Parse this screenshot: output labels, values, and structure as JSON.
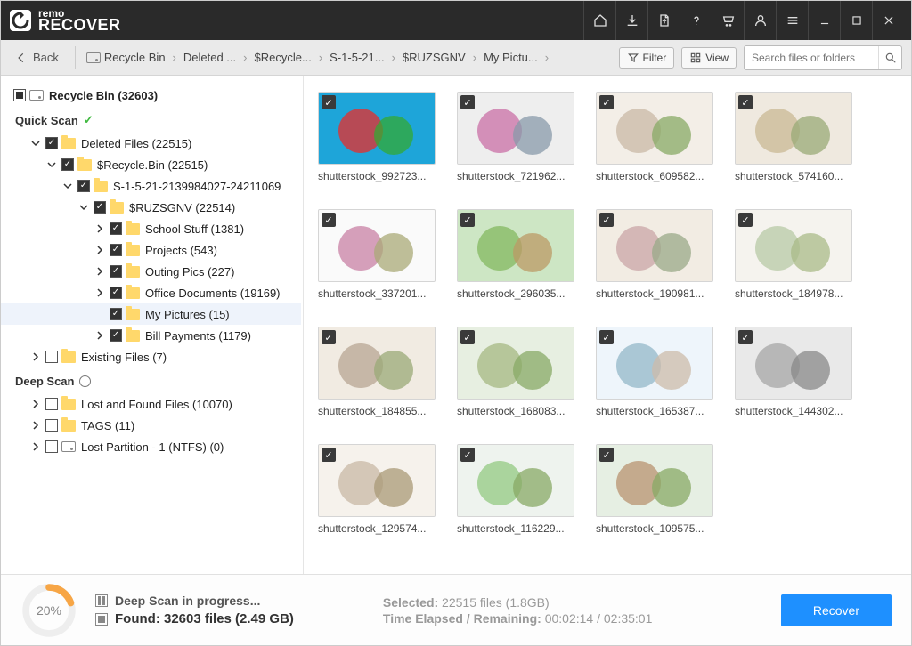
{
  "app": {
    "brand_top": "remo",
    "brand_main": "RECOVER"
  },
  "toolbar": {
    "back": "Back",
    "breadcrumb": [
      "Recycle Bin",
      "Deleted ...",
      "$Recycle...",
      "S-1-5-21...",
      "$RUZSGNV",
      "My Pictu..."
    ],
    "filter": "Filter",
    "view": "View",
    "search_placeholder": "Search files or folders"
  },
  "sidebar": {
    "root": "Recycle Bin (32603)",
    "quickscan_label": "Quick Scan",
    "deepscan_label": "Deep Scan",
    "tree": [
      {
        "label": "Deleted Files (22515)",
        "indent": 1,
        "caret": "down",
        "checked": true,
        "folder": true
      },
      {
        "label": "$Recycle.Bin (22515)",
        "indent": 2,
        "caret": "down",
        "checked": true,
        "folder": true
      },
      {
        "label": "S-1-5-21-2139984027-24211069",
        "indent": 3,
        "caret": "down",
        "checked": true,
        "folder": true
      },
      {
        "label": "$RUZSGNV (22514)",
        "indent": 4,
        "caret": "down",
        "checked": true,
        "folder": true
      },
      {
        "label": "School Stuff (1381)",
        "indent": 5,
        "caret": "right",
        "checked": true,
        "folder": true
      },
      {
        "label": "Projects (543)",
        "indent": 5,
        "caret": "right",
        "checked": true,
        "folder": true
      },
      {
        "label": "Outing Pics (227)",
        "indent": 5,
        "caret": "right",
        "checked": true,
        "folder": true
      },
      {
        "label": "Office Documents (19169)",
        "indent": 5,
        "caret": "right",
        "checked": true,
        "folder": true
      },
      {
        "label": "My Pictures (15)",
        "indent": 5,
        "caret": "none",
        "checked": true,
        "folder": true,
        "selected": true
      },
      {
        "label": "Bill Payments (1179)",
        "indent": 5,
        "caret": "right",
        "checked": true,
        "folder": true
      },
      {
        "label": "Existing Files (7)",
        "indent": 1,
        "caret": "right",
        "checked": false,
        "folder": true
      }
    ],
    "deep": [
      {
        "label": "Lost and Found Files (10070)",
        "indent": 1,
        "caret": "right",
        "checked": false,
        "folder": true
      },
      {
        "label": "TAGS (11)",
        "indent": 1,
        "caret": "right",
        "checked": false,
        "folder": true
      },
      {
        "label": "Lost Partition - 1 (NTFS) (0)",
        "indent": 1,
        "caret": "right",
        "checked": false,
        "drive": true
      }
    ]
  },
  "files": [
    {
      "name": "shutterstock_992723..."
    },
    {
      "name": "shutterstock_721962..."
    },
    {
      "name": "shutterstock_609582..."
    },
    {
      "name": "shutterstock_574160..."
    },
    {
      "name": "shutterstock_337201..."
    },
    {
      "name": "shutterstock_296035..."
    },
    {
      "name": "shutterstock_190981..."
    },
    {
      "name": "shutterstock_184978..."
    },
    {
      "name": "shutterstock_184855..."
    },
    {
      "name": "shutterstock_168083..."
    },
    {
      "name": "shutterstock_165387..."
    },
    {
      "name": "shutterstock_144302..."
    },
    {
      "name": "shutterstock_129574..."
    },
    {
      "name": "shutterstock_116229..."
    },
    {
      "name": "shutterstock_109575..."
    }
  ],
  "status": {
    "progress_percent": "20%",
    "scan_title": "Deep Scan in progress...",
    "found_label": "Found:",
    "found_value": "32603 files (2.49 GB)",
    "selected_label": "Selected:",
    "selected_value": "22515 files (1.8GB)",
    "time_label": "Time Elapsed / Remaining:",
    "time_value": "00:02:14 / 02:35:01",
    "recover": "Recover"
  },
  "thumb_colors": [
    [
      "#1ea5d9",
      "#d33",
      "#3a3"
    ],
    [
      "#eee",
      "#c7a",
      "#89a"
    ],
    [
      "#f3eee7",
      "#cba",
      "#8a6"
    ],
    [
      "#efe9df",
      "#cb9",
      "#9a7"
    ],
    [
      "#fafafa",
      "#c8a",
      "#aa7"
    ],
    [
      "#cde6c4",
      "#8b6",
      "#b96"
    ],
    [
      "#f2ece3",
      "#caa",
      "#9a8"
    ],
    [
      "#f5f3ee",
      "#bca",
      "#ab8"
    ],
    [
      "#f1ebe2",
      "#ba9",
      "#9a7"
    ],
    [
      "#e7efe1",
      "#ab8",
      "#8a6"
    ],
    [
      "#eef5fb",
      "#9bc",
      "#cba"
    ],
    [
      "#e9e9e9",
      "#aaa",
      "#888"
    ],
    [
      "#f6f2ec",
      "#cba",
      "#a97"
    ],
    [
      "#eef3ee",
      "#9c8",
      "#8a6"
    ],
    [
      "#e6efe3",
      "#b97",
      "#8a6"
    ]
  ]
}
